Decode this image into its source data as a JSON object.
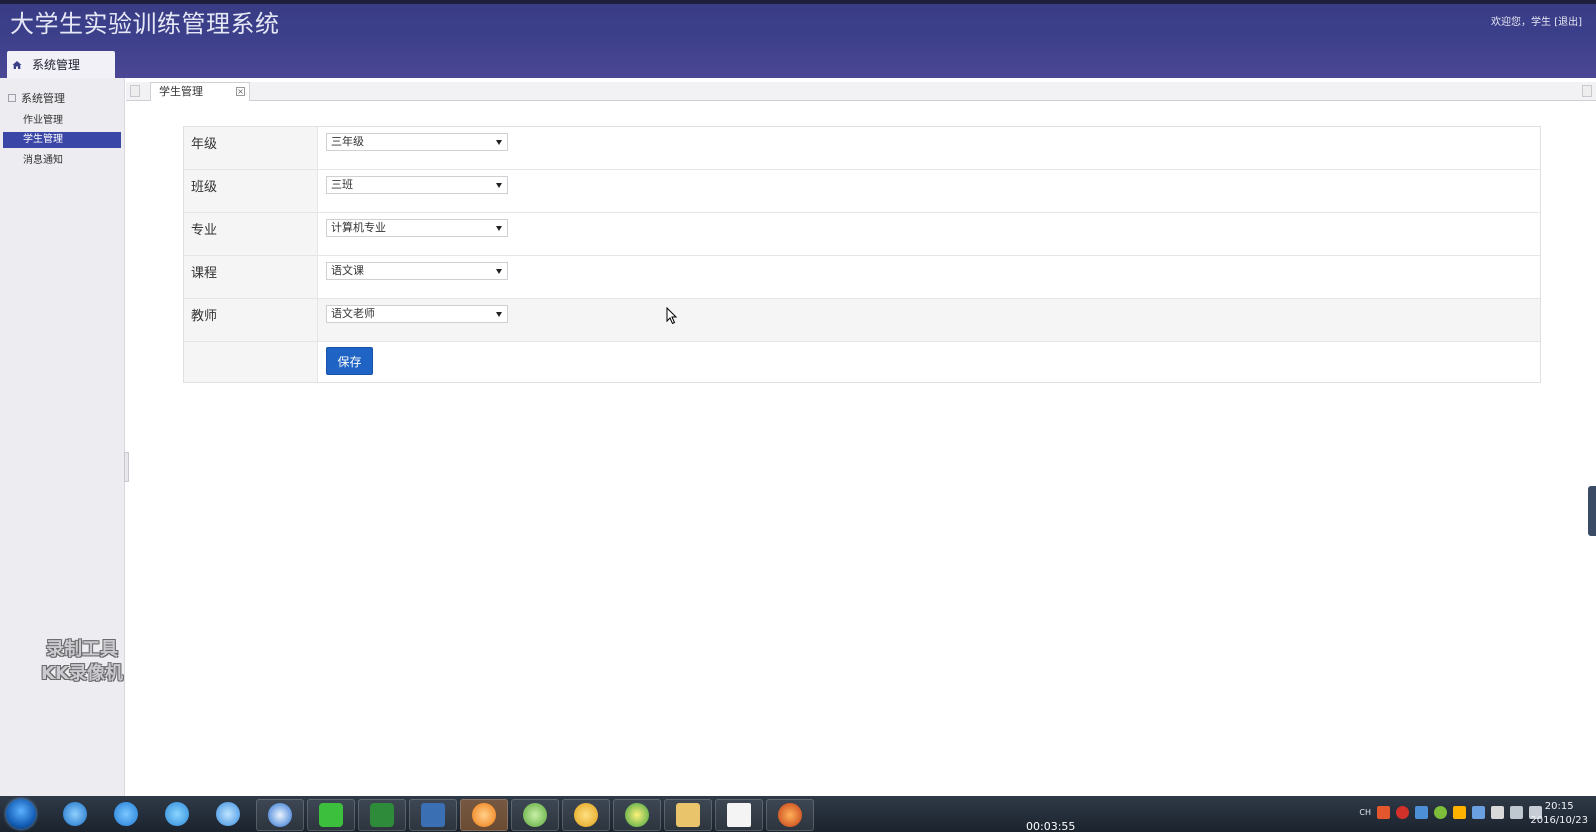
{
  "header": {
    "title": "大学生实验训练管理系统",
    "welcome_prefix": "欢迎您，学生",
    "logout_label": "[退出]",
    "menu_tab_label": "系统管理"
  },
  "sidebar": {
    "group_label": "系统管理",
    "items": [
      {
        "label": "作业管理",
        "active": false
      },
      {
        "label": "学生管理",
        "active": true
      },
      {
        "label": "消息通知",
        "active": false
      }
    ],
    "watermark_line1": "录制工具",
    "watermark_line2": "KK录像机"
  },
  "tabs": [
    {
      "label": "学生管理",
      "closable": true
    }
  ],
  "form": {
    "fields": [
      {
        "label": "年级",
        "value": "三年级"
      },
      {
        "label": "班级",
        "value": "三班"
      },
      {
        "label": "专业",
        "value": "计算机专业"
      },
      {
        "label": "课程",
        "value": "语文课"
      },
      {
        "label": "教师",
        "value": "语文老师"
      }
    ],
    "save_label": "保存"
  },
  "taskbar": {
    "lang": "CH",
    "time": "20:15",
    "date": "2016/10/23",
    "recording_time": "00:03:55"
  },
  "colors": {
    "header_bg": "#3b3f8a",
    "sidebar_active": "#3b47a6",
    "save_button": "#1f63c4"
  }
}
